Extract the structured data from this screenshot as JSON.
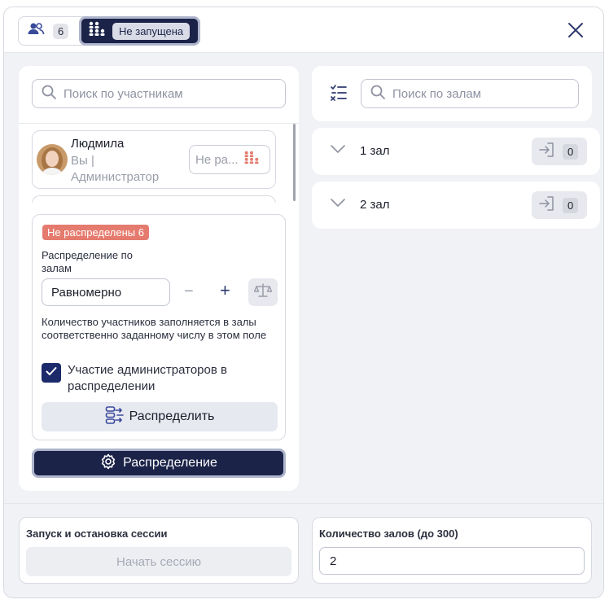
{
  "header": {
    "participants_count": "6",
    "session_status": "Не запущена"
  },
  "participants": {
    "search_placeholder": "Поиск по участникам",
    "users": [
      {
        "name": "Людмила",
        "role_line1": "Вы |",
        "role_line2": "Администратор",
        "hall_placeholder": "Не ра..."
      }
    ]
  },
  "distribution": {
    "unassigned_label": "Не распределены 6",
    "mode_label": "Распределение по залам",
    "mode_value": "Равномерно",
    "hint": "Количество участников заполняется в залы соответственно заданному числу в этом поле",
    "include_admins_label": "Участие администраторов в распределении",
    "include_admins_checked": true,
    "distribute_button": "Распределить",
    "settings_button": "Распределение"
  },
  "halls": {
    "search_placeholder": "Поиск по залам",
    "items": [
      {
        "name": "1 зал",
        "count": "0"
      },
      {
        "name": "2 зал",
        "count": "0"
      }
    ]
  },
  "footer": {
    "session_title": "Запуск и остановка сессии",
    "start_button": "Начать сессию",
    "halls_count_title": "Количество залов (до 300)",
    "halls_count_value": "2"
  },
  "colors": {
    "primary": "#1c2349",
    "accent_red": "#e57b6e",
    "background": "#f1f2f5"
  }
}
